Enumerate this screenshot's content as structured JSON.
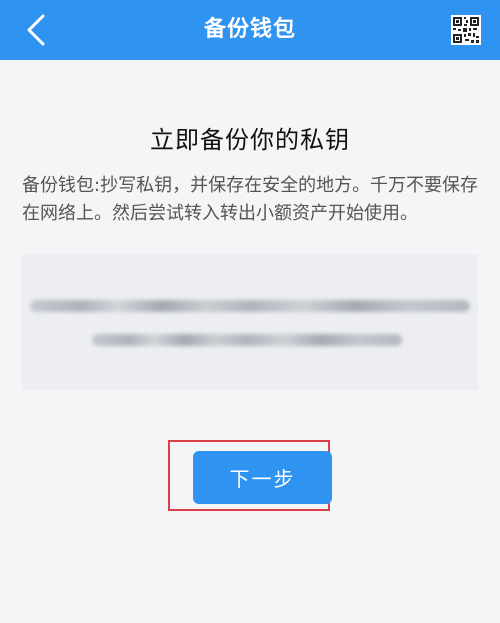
{
  "header": {
    "title": "备份钱包",
    "back_icon": "chevron-left-icon",
    "qr_icon": "qr-code-icon",
    "background_color": "#2f93f2"
  },
  "main": {
    "heading": "立即备份你的私钥",
    "description": "备份钱包:抄写私钥，并保存在安全的地方。千万不要保存在网络上。然后尝试转入转出小额资产开始使用。",
    "private_key_state": "blurred"
  },
  "actions": {
    "next_label": "下一步",
    "accent_color": "#2f93f2",
    "highlight_color": "#d9404a"
  }
}
